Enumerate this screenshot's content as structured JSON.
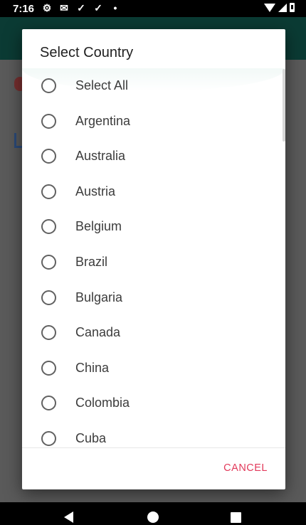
{
  "status_bar": {
    "time": "7:16",
    "icons": [
      "gear-icon",
      "mail-icon",
      "checkmark-icon",
      "checkmark-icon",
      "dot-icon"
    ],
    "right_icons": [
      "wifi-icon",
      "signal-icon",
      "battery-icon"
    ]
  },
  "dialog": {
    "title": "Select Country",
    "options": [
      "Select All",
      "Argentina",
      "Australia",
      "Austria",
      "Belgium",
      "Brazil",
      "Bulgaria",
      "Canada",
      "China",
      "Colombia",
      "Cuba"
    ],
    "cancel_label": "CANCEL"
  },
  "colors": {
    "accent": "#e23a5b",
    "app_bar": "#0b3b34",
    "radio": "#616161"
  }
}
